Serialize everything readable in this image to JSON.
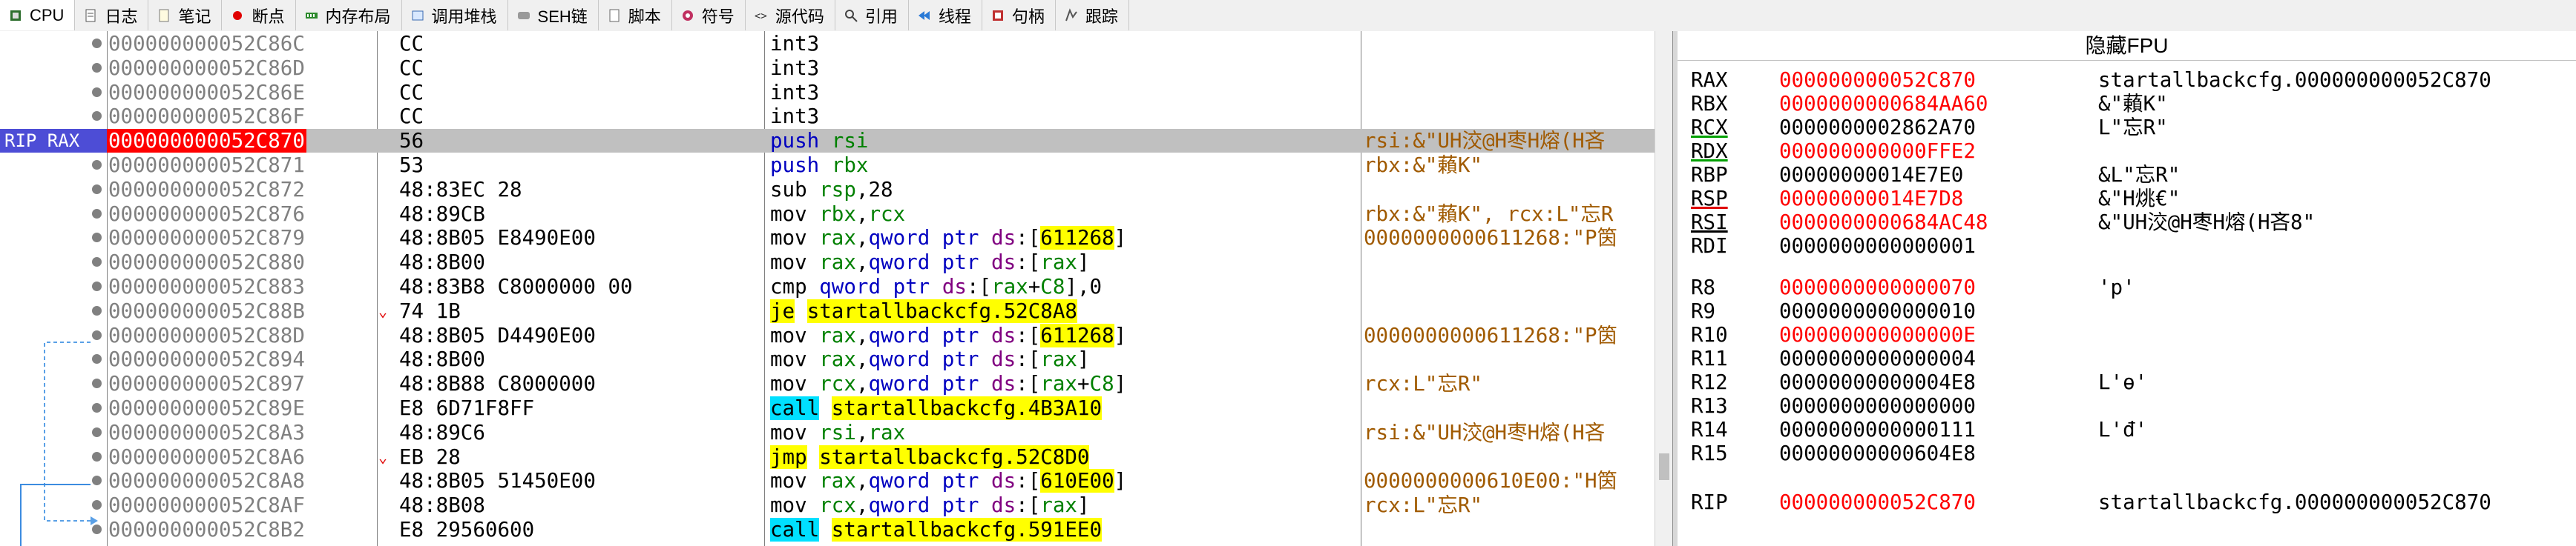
{
  "tabs": [
    {
      "label": "CPU",
      "icon": "cpu-icon",
      "active": true
    },
    {
      "label": "日志",
      "icon": "log-icon"
    },
    {
      "label": "笔记",
      "icon": "notes-icon"
    },
    {
      "label": "断点",
      "icon": "breakpoint-icon"
    },
    {
      "label": "内存布局",
      "icon": "memory-map-icon"
    },
    {
      "label": "调用堆栈",
      "icon": "call-stack-icon"
    },
    {
      "label": "SEH链",
      "icon": "seh-chain-icon"
    },
    {
      "label": "脚本",
      "icon": "script-icon"
    },
    {
      "label": "符号",
      "icon": "symbols-icon"
    },
    {
      "label": "源代码",
      "icon": "source-icon"
    },
    {
      "label": "引用",
      "icon": "references-icon"
    },
    {
      "label": "线程",
      "icon": "threads-icon"
    },
    {
      "label": "句柄",
      "icon": "handles-icon"
    },
    {
      "label": "跟踪",
      "icon": "trace-icon"
    }
  ],
  "disasm": {
    "rows": [
      {
        "label": "",
        "addr": "000000000052C86C",
        "bytes": "CC",
        "instr": [
          [
            "n",
            "int3"
          ]
        ],
        "comment": ""
      },
      {
        "label": "",
        "addr": "000000000052C86D",
        "bytes": "CC",
        "instr": [
          [
            "n",
            "int3"
          ]
        ],
        "comment": ""
      },
      {
        "label": "",
        "addr": "000000000052C86E",
        "bytes": "CC",
        "instr": [
          [
            "n",
            "int3"
          ]
        ],
        "comment": ""
      },
      {
        "label": "",
        "addr": "000000000052C86F",
        "bytes": "CC",
        "instr": [
          [
            "n",
            "int3"
          ]
        ],
        "comment": ""
      },
      {
        "label": "RIP RAX",
        "addr": "000000000052C870",
        "bytes": "56",
        "instr": [
          [
            "m",
            "push "
          ],
          [
            "r",
            "rsi"
          ]
        ],
        "comment": "rsi:&\"UH洨@H枣H熔(H吝",
        "current": true
      },
      {
        "label": "",
        "addr": "000000000052C871",
        "bytes": "53",
        "instr": [
          [
            "m",
            "push "
          ],
          [
            "r",
            "rbx"
          ]
        ],
        "comment": "rbx:&\"藾K\""
      },
      {
        "label": "",
        "addr": "000000000052C872",
        "bytes": "48:83EC 28",
        "instr": [
          [
            "n",
            "sub "
          ],
          [
            "r",
            "rsp"
          ],
          [
            "n",
            ","
          ],
          [
            "n",
            "28"
          ]
        ],
        "comment": ""
      },
      {
        "label": "",
        "addr": "000000000052C876",
        "bytes": "48:89CB",
        "instr": [
          [
            "n",
            "mov "
          ],
          [
            "r",
            "rbx"
          ],
          [
            "n",
            ","
          ],
          [
            "r",
            "rcx"
          ]
        ],
        "comment": "rbx:&\"藾K\", rcx:L\"忘R"
      },
      {
        "label": "",
        "addr": "000000000052C879",
        "bytes": "48:8B05 E8490E00",
        "instr": [
          [
            "n",
            "mov "
          ],
          [
            "r",
            "rax"
          ],
          [
            "n",
            ","
          ],
          [
            "m",
            "qword ptr "
          ],
          [
            "seg",
            "ds"
          ],
          [
            "n",
            ":["
          ],
          [
            "y",
            "611268"
          ],
          [
            "n",
            "]"
          ]
        ],
        "comment": "0000000000611268:\"P筃"
      },
      {
        "label": "",
        "addr": "000000000052C880",
        "bytes": "48:8B00",
        "instr": [
          [
            "n",
            "mov "
          ],
          [
            "r",
            "rax"
          ],
          [
            "n",
            ","
          ],
          [
            "m",
            "qword ptr "
          ],
          [
            "seg",
            "ds"
          ],
          [
            "n",
            ":["
          ],
          [
            "r",
            "rax"
          ],
          [
            "n",
            "]"
          ]
        ],
        "comment": ""
      },
      {
        "label": "",
        "addr": "000000000052C883",
        "bytes": "48:83B8 C8000000 00",
        "instr": [
          [
            "n",
            "cmp "
          ],
          [
            "m",
            "qword ptr "
          ],
          [
            "seg",
            "ds"
          ],
          [
            "n",
            ":["
          ],
          [
            "r",
            "rax"
          ],
          [
            "n",
            "+"
          ],
          [
            "r",
            "C8"
          ],
          [
            "n",
            "],0"
          ]
        ],
        "comment": ""
      },
      {
        "label": "",
        "addr": "000000000052C88B",
        "bytes": "74 1B",
        "jmark": true,
        "instr": [
          [
            "jy",
            "je"
          ],
          [
            "n",
            " "
          ],
          [
            "y",
            "startallbackcfg.52C8A8"
          ]
        ],
        "comment": ""
      },
      {
        "label": "",
        "addr": "000000000052C88D",
        "bytes": "48:8B05 D4490E00",
        "instr": [
          [
            "n",
            "mov "
          ],
          [
            "r",
            "rax"
          ],
          [
            "n",
            ","
          ],
          [
            "m",
            "qword ptr "
          ],
          [
            "seg",
            "ds"
          ],
          [
            "n",
            ":["
          ],
          [
            "y",
            "611268"
          ],
          [
            "n",
            "]"
          ]
        ],
        "comment": "0000000000611268:\"P筃"
      },
      {
        "label": "",
        "addr": "000000000052C894",
        "bytes": "48:8B00",
        "instr": [
          [
            "n",
            "mov "
          ],
          [
            "r",
            "rax"
          ],
          [
            "n",
            ","
          ],
          [
            "m",
            "qword ptr "
          ],
          [
            "seg",
            "ds"
          ],
          [
            "n",
            ":["
          ],
          [
            "r",
            "rax"
          ],
          [
            "n",
            "]"
          ]
        ],
        "comment": ""
      },
      {
        "label": "",
        "addr": "000000000052C897",
        "bytes": "48:8B88 C8000000",
        "instr": [
          [
            "n",
            "mov "
          ],
          [
            "r",
            "rcx"
          ],
          [
            "n",
            ","
          ],
          [
            "m",
            "qword ptr "
          ],
          [
            "seg",
            "ds"
          ],
          [
            "n",
            ":["
          ],
          [
            "r",
            "rax"
          ],
          [
            "n",
            "+"
          ],
          [
            "r",
            "C8"
          ],
          [
            "n",
            "]"
          ]
        ],
        "comment": "rcx:L\"忘R\""
      },
      {
        "label": "",
        "addr": "000000000052C89E",
        "bytes": "E8 6D71F8FF",
        "instr": [
          [
            "c",
            "call"
          ],
          [
            "n",
            " "
          ],
          [
            "y",
            "startallbackcfg.4B3A10"
          ]
        ],
        "comment": ""
      },
      {
        "label": "",
        "addr": "000000000052C8A3",
        "bytes": "48:89C6",
        "instr": [
          [
            "n",
            "mov "
          ],
          [
            "r",
            "rsi"
          ],
          [
            "n",
            ","
          ],
          [
            "r",
            "rax"
          ]
        ],
        "comment": "rsi:&\"UH洨@H枣H熔(H吝"
      },
      {
        "label": "",
        "addr": "000000000052C8A6",
        "bytes": "EB 28",
        "jmark": true,
        "instr": [
          [
            "jy",
            "jmp"
          ],
          [
            "n",
            " "
          ],
          [
            "y",
            "startallbackcfg.52C8D0"
          ]
        ],
        "comment": ""
      },
      {
        "label": "",
        "addr": "000000000052C8A8",
        "bytes": "48:8B05 51450E00",
        "instr": [
          [
            "n",
            "mov "
          ],
          [
            "r",
            "rax"
          ],
          [
            "n",
            ","
          ],
          [
            "m",
            "qword ptr "
          ],
          [
            "seg",
            "ds"
          ],
          [
            "n",
            ":["
          ],
          [
            "y",
            "610E00"
          ],
          [
            "n",
            "]"
          ]
        ],
        "comment": "0000000000610E00:\"H筃"
      },
      {
        "label": "",
        "addr": "000000000052C8AF",
        "bytes": "48:8B08",
        "instr": [
          [
            "n",
            "mov "
          ],
          [
            "r",
            "rcx"
          ],
          [
            "n",
            ","
          ],
          [
            "m",
            "qword ptr "
          ],
          [
            "seg",
            "ds"
          ],
          [
            "n",
            ":["
          ],
          [
            "r",
            "rax"
          ],
          [
            "n",
            "]"
          ]
        ],
        "comment": "rcx:L\"忘R\""
      },
      {
        "label": "",
        "addr": "000000000052C8B2",
        "bytes": "E8 29560600",
        "instr": [
          [
            "c",
            "call"
          ],
          [
            "n",
            " "
          ],
          [
            "y",
            "startallbackcfg.591EE0"
          ]
        ],
        "comment": ""
      }
    ]
  },
  "registers": {
    "header": "隐藏FPU",
    "gp": [
      {
        "name": "RAX",
        "value": "000000000052C870",
        "changed": true,
        "comment": "startallbackcfg.000000000052C870"
      },
      {
        "name": "RBX",
        "value": "0000000000684AA60",
        "changed": true,
        "comment": "&\"藾K\""
      },
      {
        "name": "RCX",
        "value": "0000000002862A70",
        "changed": false,
        "comment": "L\"忘R\"",
        "ul": "green"
      },
      {
        "name": "RDX",
        "value": "000000000000FFE2",
        "changed": true,
        "comment": "",
        "ul": "green"
      },
      {
        "name": "RBP",
        "value": "00000000014E7E0",
        "changed": false,
        "comment": "&L\"忘R\""
      },
      {
        "name": "RSP",
        "value": "00000000014E7D8",
        "changed": true,
        "comment": "&\"H烑€\"",
        "ul": "red"
      },
      {
        "name": "RSI",
        "value": "0000000000684AC48",
        "changed": true,
        "comment": "&\"UH洨@H枣H熔(H吝8\"",
        "ul": "black"
      },
      {
        "name": "RDI",
        "value": "0000000000000001",
        "changed": false,
        "comment": ""
      },
      {
        "name": "R8",
        "value": "0000000000000070",
        "changed": true,
        "comment": "'p'"
      },
      {
        "name": "R9",
        "value": "0000000000000010",
        "changed": false,
        "comment": ""
      },
      {
        "name": "R10",
        "value": "000000000000000E",
        "changed": true,
        "comment": ""
      },
      {
        "name": "R11",
        "value": "0000000000000004",
        "changed": false,
        "comment": ""
      },
      {
        "name": "R12",
        "value": "00000000000004E8",
        "changed": false,
        "comment": "L'ө'"
      },
      {
        "name": "R13",
        "value": "0000000000000000",
        "changed": false,
        "comment": ""
      },
      {
        "name": "R14",
        "value": "0000000000000111",
        "changed": false,
        "comment": "L'đ'"
      },
      {
        "name": "R15",
        "value": "00000000000604E8",
        "changed": false,
        "comment": ""
      },
      {
        "name": "RIP",
        "value": "000000000052C870",
        "changed": true,
        "comment": "startallbackcfg.000000000052C870"
      }
    ]
  },
  "colors": {
    "rip_label_bg": "#4d4dd6",
    "current_addr_bg": "#ff0000",
    "changed_register": "#ff0000",
    "branch_highlight": "#ffff00",
    "call_highlight": "#00e0ff",
    "comment_text": "#a05a00"
  }
}
